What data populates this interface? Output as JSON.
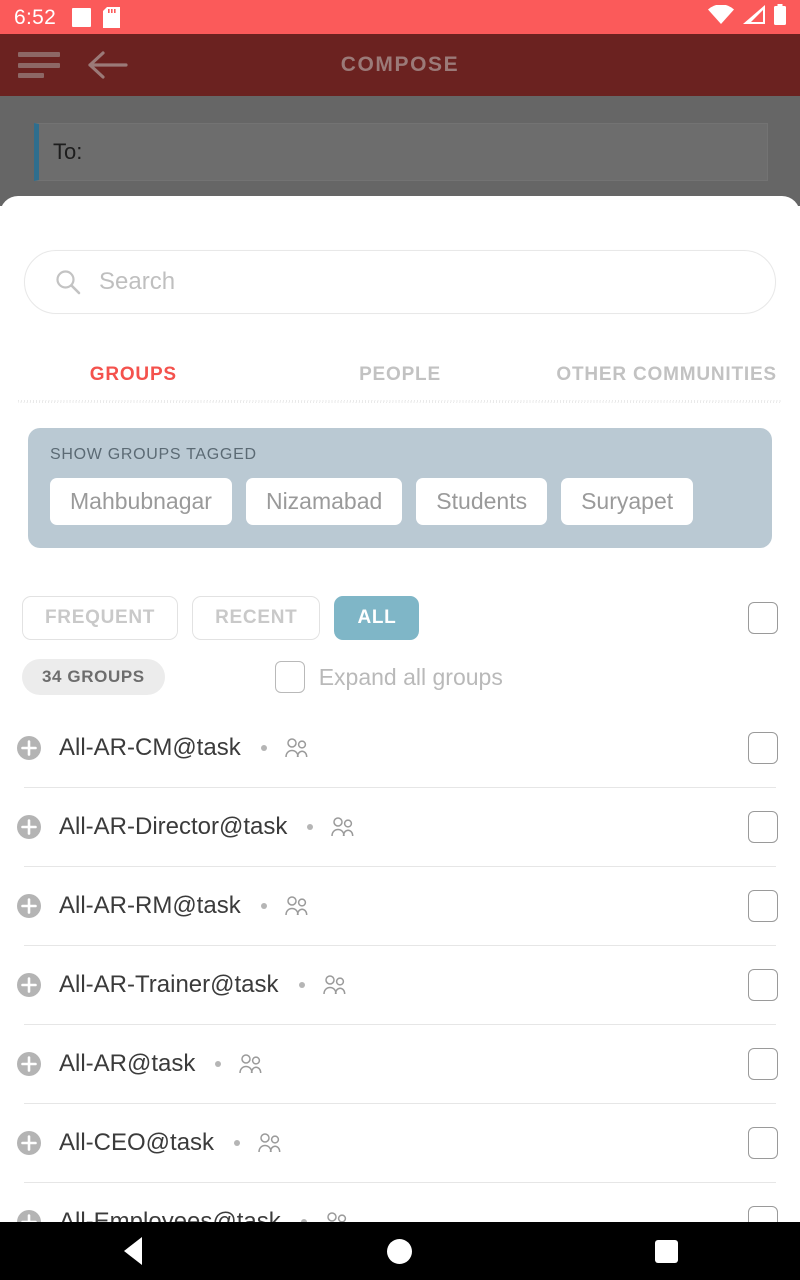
{
  "status_bar": {
    "time": "6:52",
    "background": "#fb5a5a",
    "left_icons": [
      "white-square-icon",
      "sd-card-icon"
    ],
    "right_icons": [
      "wifi-icon",
      "signal-icon",
      "battery-icon"
    ]
  },
  "app_bar": {
    "title": "COMPOSE",
    "background": "#6b2220",
    "menu_icon": "hamburger-icon",
    "back_icon": "back-arrow-icon"
  },
  "compose": {
    "to_label": "To:",
    "to_value": "",
    "accent": "#2e6e8e"
  },
  "search": {
    "placeholder": "Search",
    "value": "",
    "icon": "search-icon"
  },
  "tabs": [
    {
      "label": "GROUPS",
      "active": true
    },
    {
      "label": "PEOPLE",
      "active": false
    },
    {
      "label": "OTHER COMMUNITIES",
      "active": false
    }
  ],
  "tag_panel": {
    "label": "SHOW GROUPS TAGGED",
    "background": "#bac9d3",
    "tags": [
      "Mahbubnagar",
      "Nizamabad",
      "Students",
      "Suryapet"
    ]
  },
  "filters": {
    "buttons": [
      {
        "label": "FREQUENT",
        "active": false
      },
      {
        "label": "RECENT",
        "active": false
      },
      {
        "label": "ALL",
        "active": true
      }
    ],
    "active_color": "#7fb6c7",
    "select_all_checked": false
  },
  "list_header": {
    "count_label": "34 GROUPS",
    "expand_label": "Expand all groups",
    "expand_checked": false
  },
  "groups": [
    {
      "name": "All-AR-CM@task",
      "checked": false
    },
    {
      "name": "All-AR-Director@task",
      "checked": false
    },
    {
      "name": "All-AR-RM@task",
      "checked": false
    },
    {
      "name": "All-AR-Trainer@task",
      "checked": false
    },
    {
      "name": "All-AR@task",
      "checked": false
    },
    {
      "name": "All-CEO@task",
      "checked": false
    },
    {
      "name": "All-Employees@task",
      "checked": false
    }
  ],
  "nav_bar": {
    "back": "back-triangle-icon",
    "home": "home-circle-icon",
    "recents": "recents-square-icon"
  }
}
